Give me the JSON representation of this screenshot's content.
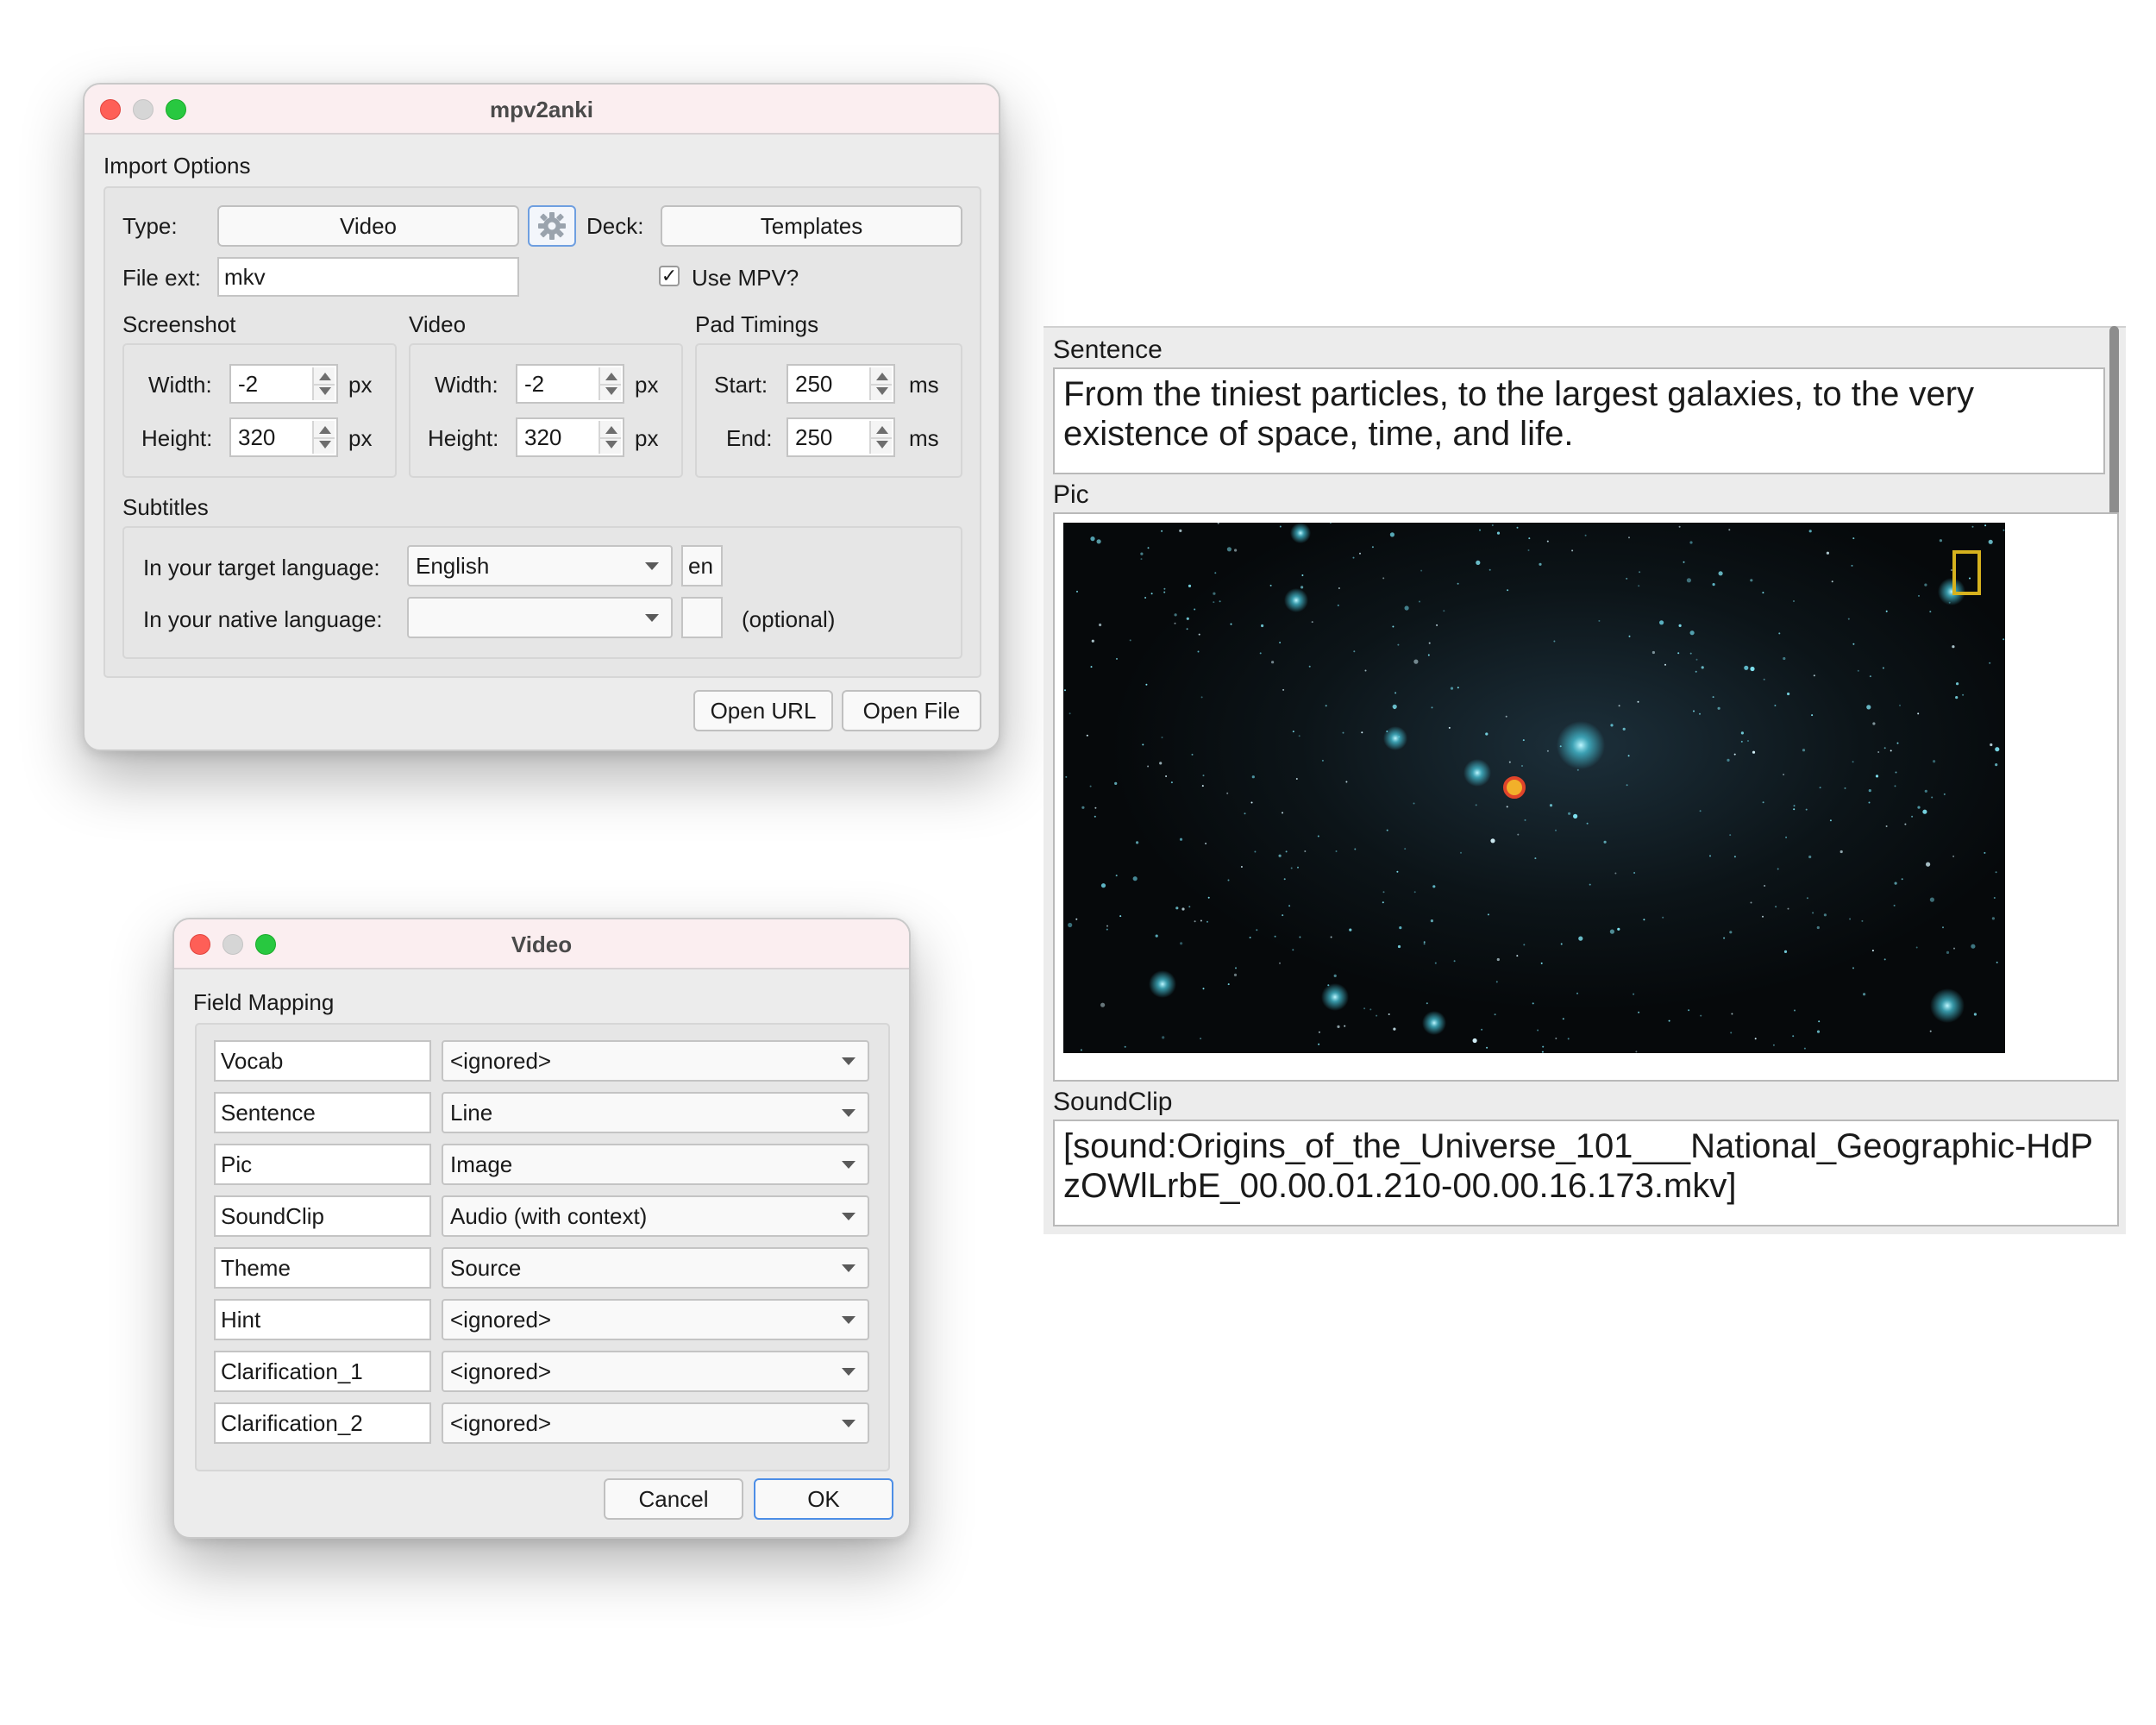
{
  "main_window": {
    "title": "mpv2anki",
    "import_options_title": "Import Options",
    "type_label": "Type:",
    "type_button": "Video",
    "settings_icon": "gear-icon",
    "deck_label": "Deck:",
    "deck_button": "Templates",
    "file_ext_label": "File ext:",
    "file_ext_value": "mkv",
    "use_mpv_label": "Use MPV?",
    "use_mpv_checked": "✓",
    "screenshot": {
      "title": "Screenshot",
      "width_label": "Width:",
      "width_value": "-2",
      "width_unit": "px",
      "height_label": "Height:",
      "height_value": "320",
      "height_unit": "px"
    },
    "video": {
      "title": "Video",
      "width_label": "Width:",
      "width_value": "-2",
      "width_unit": "px",
      "height_label": "Height:",
      "height_value": "320",
      "height_unit": "px"
    },
    "pad_timings": {
      "title": "Pad Timings",
      "start_label": "Start:",
      "start_value": "250",
      "start_unit": "ms",
      "end_label": "End:",
      "end_value": "250",
      "end_unit": "ms"
    },
    "subtitles": {
      "title": "Subtitles",
      "target_label": "In your target language:",
      "target_value": "English",
      "target_code": "en",
      "native_label": "In your native language:",
      "native_value": "",
      "native_code": "",
      "optional_label": "(optional)"
    },
    "open_url_button": "Open URL",
    "open_file_button": "Open File"
  },
  "video_window": {
    "title": "Video",
    "field_mapping_title": "Field Mapping",
    "rows": [
      {
        "field": "Vocab",
        "mapping": "<ignored>"
      },
      {
        "field": "Sentence",
        "mapping": "Line"
      },
      {
        "field": "Pic",
        "mapping": "Image"
      },
      {
        "field": "SoundClip",
        "mapping": "Audio (with context)"
      },
      {
        "field": "Theme",
        "mapping": "Source"
      },
      {
        "field": "Hint",
        "mapping": "<ignored>"
      },
      {
        "field": "Clarification_1",
        "mapping": "<ignored>"
      },
      {
        "field": "Clarification_2",
        "mapping": "<ignored>"
      }
    ],
    "cancel_button": "Cancel",
    "ok_button": "OK"
  },
  "editor": {
    "sentence_label": "Sentence",
    "sentence_text": "From the tiniest particles, to the largest galaxies, to the very existence of space, time, and life.",
    "pic_label": "Pic",
    "soundclip_label": "SoundClip",
    "soundclip_text": "[sound:Origins_of_the_Universe_101___National_Geographic-HdPzOWlLrbE_00.00.01.210-00.00.16.173.mkv]"
  }
}
